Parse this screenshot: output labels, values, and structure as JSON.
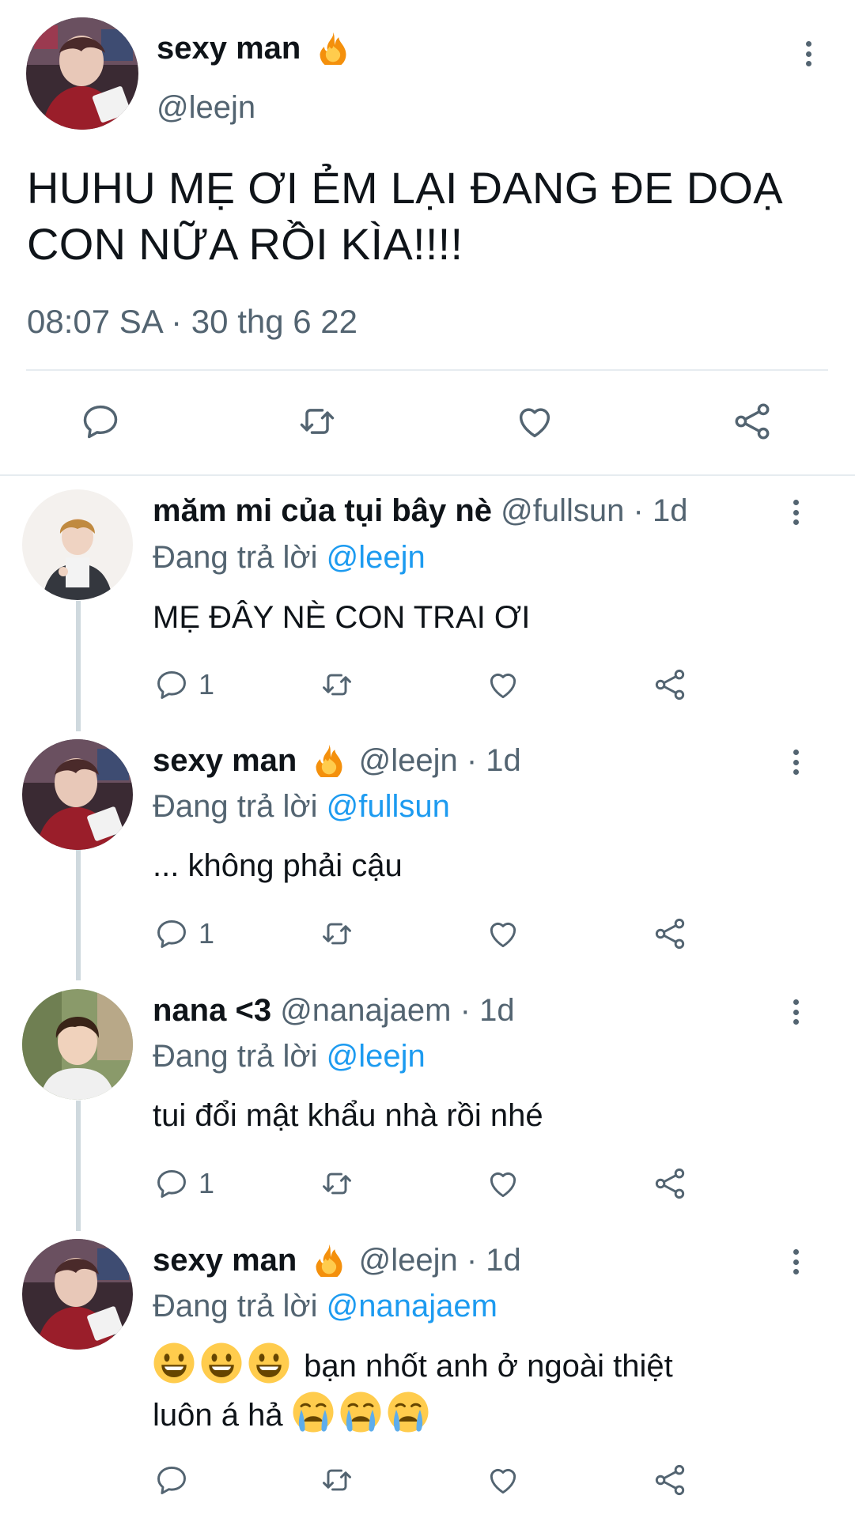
{
  "main_tweet": {
    "author_name": "sexy man",
    "author_emoji": "fire",
    "handle": "@leejn",
    "text": "HUHU MẸ ƠI ẺM LẠI ĐANG ĐE DOẠ CON NỮA RỒI KÌA!!!!",
    "timestamp": "08:07 SA · 30 thg 6 22",
    "actions": [
      "reply-icon",
      "retweet-icon",
      "like-icon",
      "share-icon"
    ]
  },
  "replies": [
    {
      "name": "măm mi của tụi bây nè",
      "handle": "@fullsun",
      "time": "1d",
      "replying_label": "Đang trả lời",
      "replying_to": "@leejn",
      "text": "MẸ ĐÂY NÈ CON TRAI ƠI",
      "reply_count": "1"
    },
    {
      "name": "sexy man",
      "name_emoji": "fire",
      "handle": "@leejn",
      "time": "1d",
      "replying_label": "Đang trả lời",
      "replying_to": "@fullsun",
      "text": "... không phải cậu",
      "reply_count": "1"
    },
    {
      "name": "nana <3",
      "handle": "@nanajaem",
      "time": "1d",
      "replying_label": "Đang trả lời",
      "replying_to": "@leejn",
      "text": "tui đổi mật khẩu nhà rồi nhé",
      "reply_count": "1"
    },
    {
      "name": "sexy man",
      "name_emoji": "fire",
      "handle": "@leejn",
      "time": "1d",
      "replying_label": "Đang trả lời",
      "replying_to": "@nanajaem",
      "text_part1": "bạn nhốt anh ở ngoài thiệt",
      "text_part2": "luôn á hả",
      "lead_emojis": [
        "smiley",
        "smiley",
        "smiley"
      ],
      "trail_emojis": [
        "loudly-crying",
        "loudly-crying",
        "loudly-crying"
      ],
      "reply_count": ""
    }
  ],
  "colors": {
    "text": "#0f1419",
    "secondary": "#536471",
    "link": "#1d9bf0",
    "divider": "#e6ecf0",
    "thread_line": "#cfd9de"
  }
}
